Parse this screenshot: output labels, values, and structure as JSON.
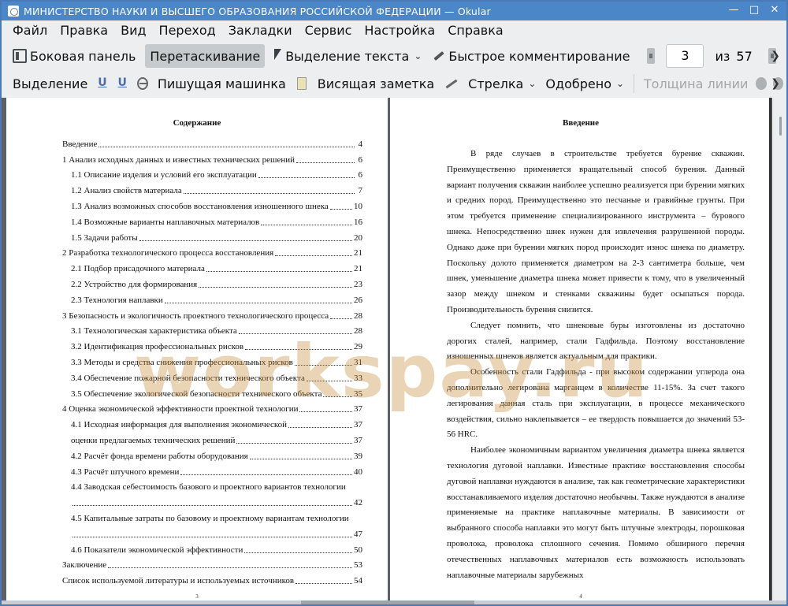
{
  "window": {
    "title": "МИНИСТЕРСТВО НАУКИ И ВЫСШЕГО ОБРАЗОВАНИЯ  РОССИЙСКОЙ ФЕДЕРАЦИИ — Okular"
  },
  "menu": [
    "Файл",
    "Правка",
    "Вид",
    "Переход",
    "Закладки",
    "Сервис",
    "Настройка",
    "Справка"
  ],
  "toolbar": {
    "sidebar_label": "Боковая панель",
    "drag_label": "Перетаскивание",
    "text_select_label": "Выделение текста",
    "quick_comment_label": "Быстрое комментирование",
    "current_page": "3",
    "of_label": "из",
    "total_pages": "57"
  },
  "annot_toolbar": {
    "highlight_label": "Выделение",
    "typewriter_label": "Пишущая машинка",
    "sticky_note_label": "Висящая заметка",
    "arrow_label": "Стрелка",
    "approved_label": "Одобрено",
    "line_width_label": "Толщина линии"
  },
  "left_page": {
    "heading": "Содержание",
    "page_number": "3",
    "toc": [
      {
        "title": "Введение",
        "page": "4",
        "sub": false
      },
      {
        "title": "1 Анализ исходных данных и известных технических решений",
        "page": "6",
        "sub": false
      },
      {
        "title": "1.1 Описание изделия и условий его эксплуатации",
        "page": "6",
        "sub": true
      },
      {
        "title": "1.2 Анализ свойств материала",
        "page": "7",
        "sub": true
      },
      {
        "title": "1.3 Анализ возможных способов восстановления изношенного шнека",
        "page": "10",
        "sub": true
      },
      {
        "title": "1.4 Возможные варианты наплавочных материалов",
        "page": "16",
        "sub": true
      },
      {
        "title": "1.5 Задачи работы",
        "page": "20",
        "sub": true
      },
      {
        "title": "2 Разработка технологического процесса восстановления",
        "page": "21",
        "sub": false
      },
      {
        "title": "2.1 Подбор присадочного материала",
        "page": "21",
        "sub": true
      },
      {
        "title": "2.2 Устройство для формирования",
        "page": "23",
        "sub": true
      },
      {
        "title": "2.3 Технология наплавки",
        "page": "26",
        "sub": true
      },
      {
        "title": "3 Безопасность и экологичность проектного технологического процесса",
        "page": "28",
        "sub": false
      },
      {
        "title": "3.1 Технологическая характеристика объекта",
        "page": "28",
        "sub": true
      },
      {
        "title": "3.2 Идентификация профессиональных рисков",
        "page": "29",
        "sub": true
      },
      {
        "title": "3.3 Методы и средства снижения профессиональных рисков",
        "page": "31",
        "sub": true
      },
      {
        "title": "3.4 Обеспечение пожарной безопасности технического объекта",
        "page": "33",
        "sub": true
      },
      {
        "title": "3.5 Обеспечение экологической безопасности технического объекта",
        "page": "35",
        "sub": true
      },
      {
        "title": "4 Оценка экономической эффективности проектной технологии",
        "page": "37",
        "sub": false
      },
      {
        "title": "4.1 Исходная информация для выполнения экономической",
        "page": "37",
        "sub": true
      },
      {
        "title": "оценки предлагаемых технических решений",
        "page": "37",
        "sub": true
      },
      {
        "title": "4.2 Расчёт фонда времени работы оборудования",
        "page": "39",
        "sub": true
      },
      {
        "title": "4.3 Расчёт штучного времени",
        "page": "40",
        "sub": true
      },
      {
        "title": "4.4 Заводская себестоимость базового и проектного вариантов технологии",
        "page": "",
        "sub": true
      },
      {
        "title": "",
        "page": "42",
        "sub": true
      },
      {
        "title": "4.5 Капитальные затраты по базовому и проектному вариантам технологии",
        "page": "",
        "sub": true
      },
      {
        "title": "",
        "page": "47",
        "sub": true
      },
      {
        "title": "4.6 Показатели экономической эффективности",
        "page": "50",
        "sub": true
      },
      {
        "title": "Заключение",
        "page": "53",
        "sub": false
      },
      {
        "title": "Список используемой литературы и используемых источников",
        "page": "54",
        "sub": false
      }
    ]
  },
  "right_page": {
    "heading": "Введение",
    "page_number": "4",
    "paragraphs": [
      "В ряде случаев в строительстве требуется бурение скважин. Преимущественно применяется вращательный способ бурения. Данный вариант получения скважин наиболее успешно реализуется при бурении мягких и средних пород. Преимущественно это песчаные и гравийные грунты. При этом требуется применение специализированного инструмента – бурового шнека. Непосредственно шнек нужен для извлечения разрушенной породы. Однако даже при бурении мягких пород происходит износ шнека по диаметру. Поскольку долото применяется диаметром на 2-3 сантиметра больше, чем шнек, уменьшение диаметра шнека может привести к тому, что в увеличенный зазор между шнеком и стенками скважины будет осыпаться порода. Производительность бурения снизится.",
      "Следует помнить, что шнековые буры изготовлены из достаточно дорогих сталей, например, стали Гадфильда. Поэтому восстановление изношенных шнеков является актуальным для практики.",
      "Особенность стали Гадфильда - при высоком содержании углерода она дополнительно легирована марганцем в количестве 11-15%. За счет такого легирования данная сталь при эксплуатации, в процессе механического воздействия, сильно наклепывается – ее твердость повышается до значений 53-56 HRC.",
      "Наиболее экономичным вариантом увеличения диаметра шнека является технология дуговой наплавки. Известные практике восстановления способы дуговой наплавки нуждаются в анализе, так как геометрические характеристики восстанавливаемого изделия достаточно необычны. Также нуждаются в анализе применяемые на практике наплавочные материалы. В зависимости от выбранного способа наплавки это могут быть штучные электроды, порошковая проволока, проволока сплошного сечения. Помимо обширного перечня отечественных наплавочных материалов есть возможность использовать наплавочные материалы зарубежных"
    ]
  },
  "watermark": "workspay.ru"
}
